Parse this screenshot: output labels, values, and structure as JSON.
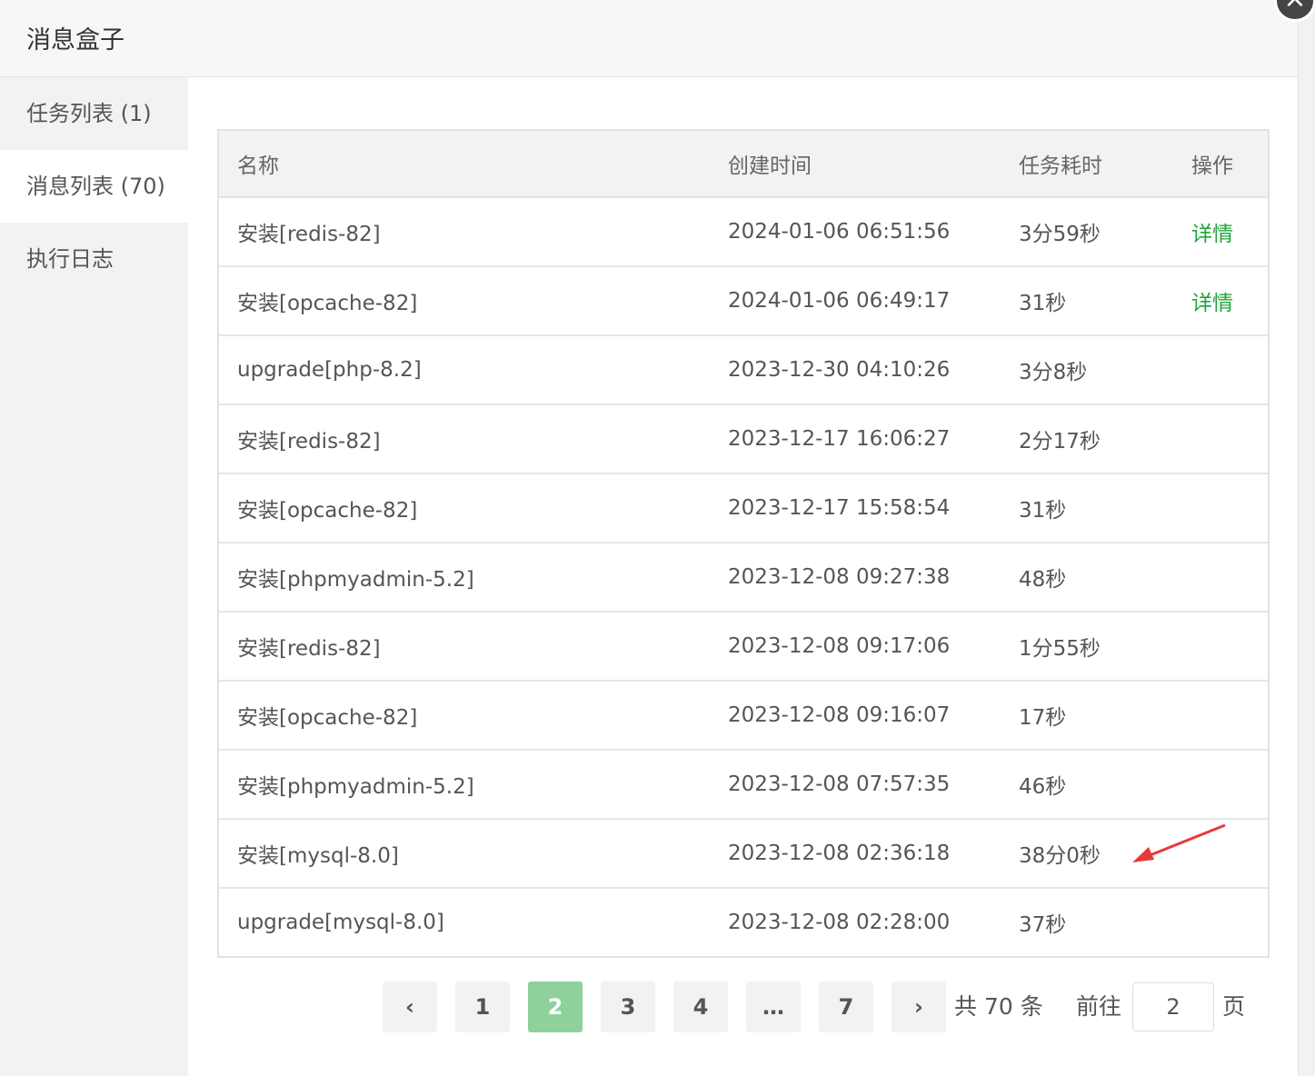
{
  "title": "消息盒子",
  "close_icon": "×",
  "sidebar": {
    "items": [
      {
        "label": "任务列表 (1)"
      },
      {
        "label": "消息列表 (70)"
      },
      {
        "label": "执行日志"
      }
    ]
  },
  "table": {
    "headers": [
      "名称",
      "创建时间",
      "任务耗时",
      "操作"
    ],
    "rows": [
      {
        "name": "安装[redis-82]",
        "time": "2024-01-06 06:51:56",
        "duration": "3分59秒",
        "action": "详情"
      },
      {
        "name": "安装[opcache-82]",
        "time": "2024-01-06 06:49:17",
        "duration": "31秒",
        "action": "详情"
      },
      {
        "name": "upgrade[php-8.2]",
        "time": "2023-12-30 04:10:26",
        "duration": "3分8秒",
        "action": ""
      },
      {
        "name": "安装[redis-82]",
        "time": "2023-12-17 16:06:27",
        "duration": "2分17秒",
        "action": ""
      },
      {
        "name": "安装[opcache-82]",
        "time": "2023-12-17 15:58:54",
        "duration": "31秒",
        "action": ""
      },
      {
        "name": "安装[phpmyadmin-5.2]",
        "time": "2023-12-08 09:27:38",
        "duration": "48秒",
        "action": ""
      },
      {
        "name": "安装[redis-82]",
        "time": "2023-12-08 09:17:06",
        "duration": "1分55秒",
        "action": ""
      },
      {
        "name": "安装[opcache-82]",
        "time": "2023-12-08 09:16:07",
        "duration": "17秒",
        "action": ""
      },
      {
        "name": "安装[phpmyadmin-5.2]",
        "time": "2023-12-08 07:57:35",
        "duration": "46秒",
        "action": ""
      },
      {
        "name": "安装[mysql-8.0]",
        "time": "2023-12-08 02:36:18",
        "duration": "38分0秒",
        "action": ""
      },
      {
        "name": "upgrade[mysql-8.0]",
        "time": "2023-12-08 02:28:00",
        "duration": "37秒",
        "action": ""
      }
    ]
  },
  "pagination": {
    "prev": "‹",
    "next": "›",
    "pages": [
      "1",
      "2",
      "3",
      "4",
      "…",
      "7"
    ],
    "current": "2",
    "total_text": "共 70 条",
    "goto_prefix": "前往",
    "goto_value": "2",
    "goto_suffix": "页"
  },
  "colors": {
    "accent_green": "#20a53a",
    "active_page": "#8ed19d",
    "annotation_arrow": "#e83a3a"
  }
}
